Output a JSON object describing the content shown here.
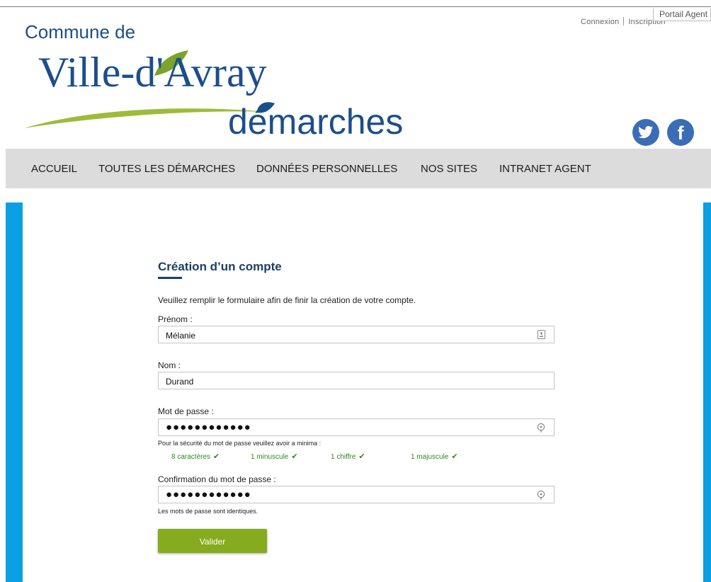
{
  "header": {
    "portal_tab": "Portail Agent",
    "login_link": "Connexion",
    "register_link": "Inscription",
    "logo": {
      "prefix": "Commune de",
      "name": "Ville-d'Avray",
      "subtitle": "démarches"
    },
    "social": {
      "twitter_icon": "twitter-icon",
      "facebook_glyph": "f"
    }
  },
  "nav": {
    "items": [
      {
        "label": "ACCUEIL"
      },
      {
        "label": "TOUTES LES DÉMARCHES"
      },
      {
        "label": "DONNÉES PERSONNELLES"
      },
      {
        "label": "NOS SITES"
      },
      {
        "label": "INTRANET AGENT"
      }
    ]
  },
  "form": {
    "title": "Création d’un compte",
    "intro": "Veuillez remplir le formulaire afin de finir la création de votre compte.",
    "first_name": {
      "label": "Prénom :",
      "value": "Mélanie"
    },
    "last_name": {
      "label": "Nom :",
      "value": "Durand"
    },
    "password": {
      "label": "Mot de passe :",
      "value": "●●●●●●●●●●●●",
      "hint": "Pour la sécurité du mot de passe veuillez avoir a minima :",
      "rules": [
        {
          "text": "8 caractères",
          "met": true
        },
        {
          "text": "1 minuscule",
          "met": true
        },
        {
          "text": "1 chiffre",
          "met": true
        },
        {
          "text": "1 majuscule",
          "met": true
        }
      ]
    },
    "confirm_password": {
      "label": "Confirmation du mot de passe :",
      "value": "●●●●●●●●●●●●",
      "hint": "Les mots de passe sont identiques."
    },
    "submit_label": "Valider"
  },
  "colors": {
    "brand_blue": "#1c4e8a",
    "nav_bg": "#dcdcdc",
    "side_blue": "#0aa0e1",
    "button_green": "#86ab1e",
    "valid_green": "#2f8a1f"
  }
}
